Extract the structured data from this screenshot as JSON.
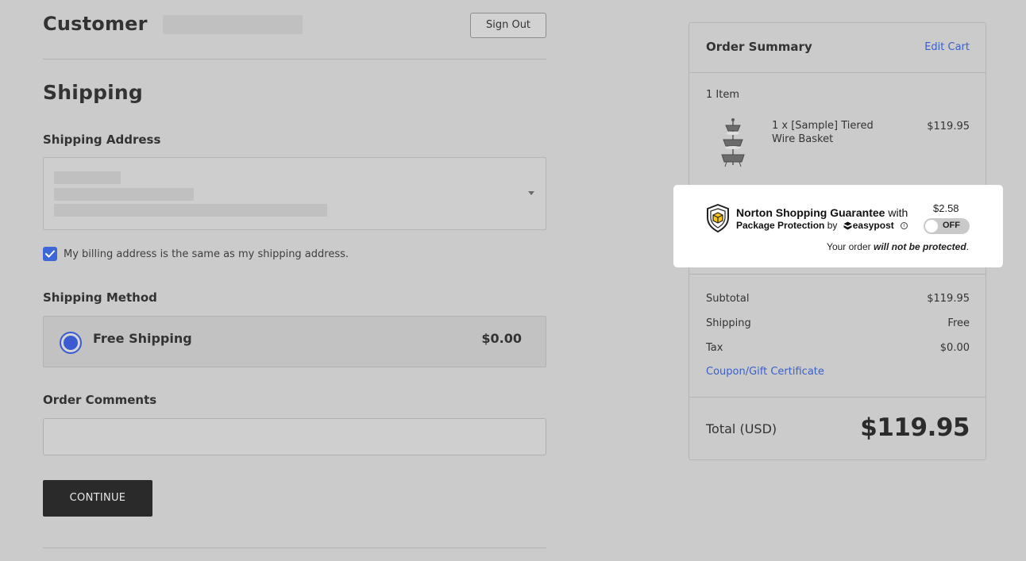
{
  "customer": {
    "title": "Customer",
    "sign_out_label": "Sign Out"
  },
  "shipping": {
    "title": "Shipping",
    "address_label": "Shipping Address",
    "billing_same_label": "My billing address is the same as my shipping address.",
    "billing_same_checked": true,
    "method_label": "Shipping Method",
    "method": {
      "name": "Free Shipping",
      "price": "$0.00",
      "selected": true
    },
    "comments_label": "Order Comments",
    "comments_value": "",
    "continue_label": "CONTINUE"
  },
  "summary": {
    "title": "Order Summary",
    "edit_cart_label": "Edit Cart",
    "item_count": "1 Item",
    "items": [
      {
        "name": "1 x [Sample] Tiered Wire Basket",
        "price": "$119.95"
      }
    ],
    "rows": [
      {
        "label": "Subtotal",
        "value": "$119.95"
      },
      {
        "label": "Shipping",
        "value": "Free"
      },
      {
        "label": "Tax",
        "value": "$0.00"
      }
    ],
    "coupon_label": "Coupon/Gift Certificate",
    "total_label": "Total (USD)",
    "total_value": "$119.95"
  },
  "protection": {
    "title_bold": "Norton Shopping Guarantee",
    "title_suffix": " with",
    "subtitle_bold": "Package Protection",
    "subtitle_by": " by ",
    "provider": "easypost",
    "price": "$2.58",
    "toggle_label": "OFF",
    "toggle_on": false,
    "note_prefix": "Your order ",
    "note_emphasis": "will not be protected",
    "note_suffix": "."
  },
  "colors": {
    "accent_blue": "#3d5bd1",
    "link_blue": "#3b5fc9",
    "button_dark": "#2a2a2a",
    "page_bg": "#cbcbcb"
  }
}
